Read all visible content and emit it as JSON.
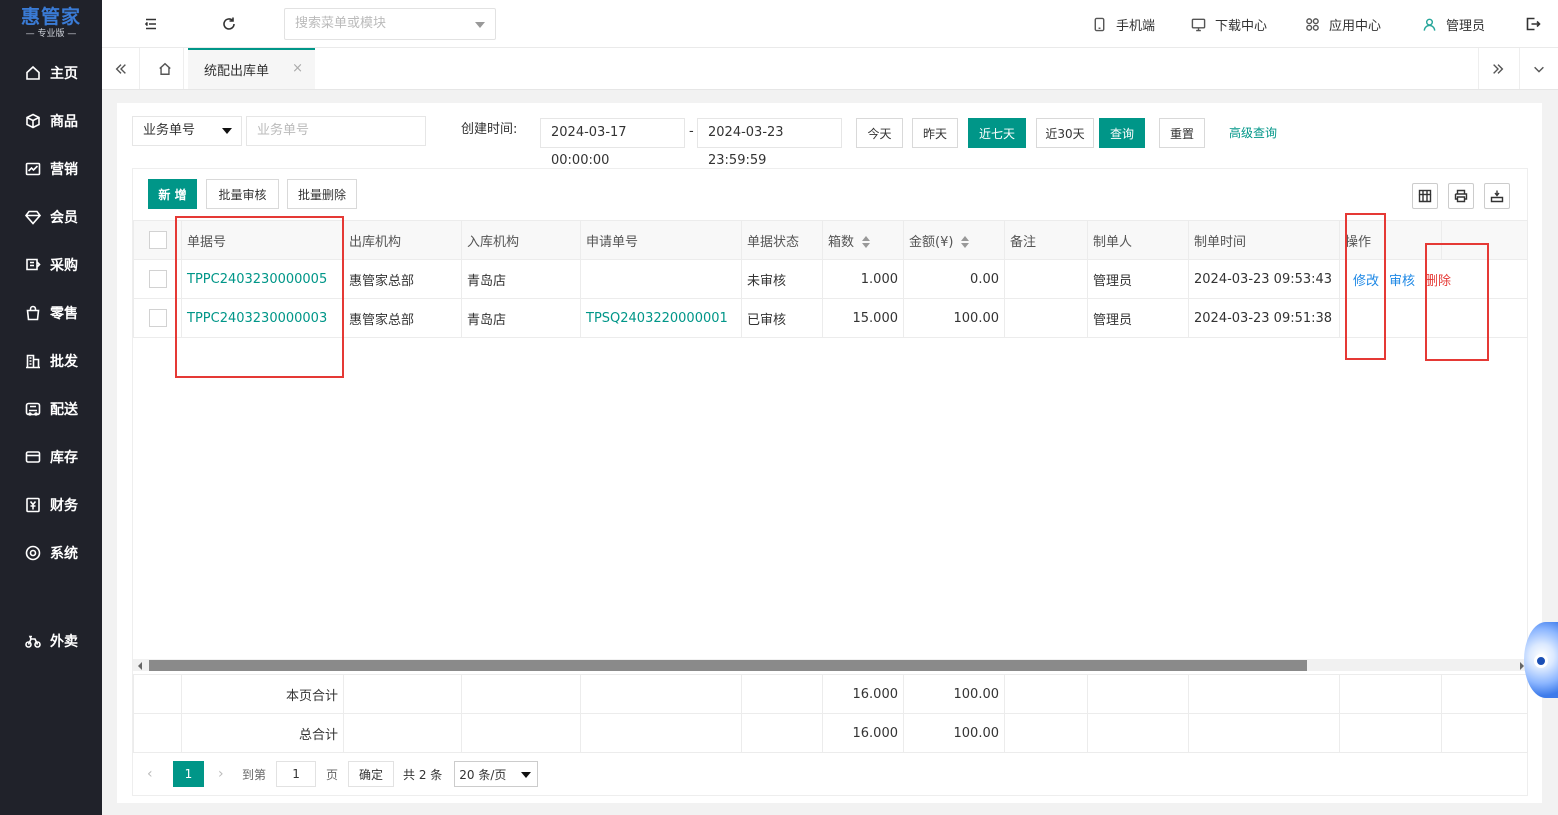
{
  "brand": {
    "name": "惠管家",
    "edition": "专业版",
    "accent": "#3a7bd5"
  },
  "colors": {
    "primary": "#009688",
    "sidebar_bg": "#20222a",
    "link_blue": "#1e88e5",
    "danger": "#e53935"
  },
  "sidebar": {
    "items": [
      {
        "label": "主页",
        "icon": "home-icon"
      },
      {
        "label": "商品",
        "icon": "box-icon"
      },
      {
        "label": "营销",
        "icon": "chart-icon"
      },
      {
        "label": "会员",
        "icon": "diamond-icon"
      },
      {
        "label": "采购",
        "icon": "purchase-icon"
      },
      {
        "label": "零售",
        "icon": "bag-icon"
      },
      {
        "label": "批发",
        "icon": "building-icon"
      },
      {
        "label": "配送",
        "icon": "truck-icon"
      },
      {
        "label": "库存",
        "icon": "stock-icon"
      },
      {
        "label": "财务",
        "icon": "money-icon"
      },
      {
        "label": "系统",
        "icon": "settings-icon"
      },
      {
        "label": "外卖",
        "icon": "bike-icon"
      }
    ]
  },
  "header": {
    "search_placeholder": "搜索菜单或模块",
    "links": {
      "mobile": "手机端",
      "download": "下载中心",
      "apps": "应用中心",
      "user": "管理员"
    }
  },
  "tabs": {
    "active": "统配出库单",
    "close": "×"
  },
  "filter": {
    "field_select": "业务单号",
    "field_placeholder": "业务单号",
    "created_label": "创建时间:",
    "date_from": "2024-03-17 00:00:00",
    "date_sep": "-",
    "date_to": "2024-03-23 23:59:59",
    "today": "今天",
    "yesterday": "昨天",
    "last7": "近七天",
    "last30": "近30天",
    "query": "查询",
    "reset": "重置",
    "advanced": "高级查询"
  },
  "toolbar": {
    "add": "新 增",
    "batch_audit": "批量审核",
    "batch_delete": "批量删除"
  },
  "table": {
    "columns": [
      "单据号",
      "出库机构",
      "入库机构",
      "申请单号",
      "单据状态",
      "箱数",
      "金额(¥)",
      "备注",
      "制单人",
      "制单时间",
      "操作"
    ],
    "rows": [
      {
        "doc_no": "TPPC2403230000005",
        "out_org": "惠管家总部",
        "in_org": "青岛店",
        "apply_no": "",
        "status": "未审核",
        "boxes": "1.000",
        "amount": "0.00",
        "remark": "",
        "maker": "管理员",
        "time": "2024-03-23 09:53:43",
        "op_edit": "修改",
        "op_audit": "审核",
        "op_delete": "删除"
      },
      {
        "doc_no": "TPPC2403230000003",
        "out_org": "惠管家总部",
        "in_org": "青岛店",
        "apply_no": "TPSQ2403220000001",
        "status": "已审核",
        "boxes": "15.000",
        "amount": "100.00",
        "remark": "",
        "maker": "管理员",
        "time": "2024-03-23 09:51:38",
        "op_edit": "",
        "op_audit": "",
        "op_delete": ""
      }
    ],
    "totals": [
      {
        "label": "本页合计",
        "boxes": "16.000",
        "amount": "100.00"
      },
      {
        "label": "总合计",
        "boxes": "16.000",
        "amount": "100.00"
      }
    ]
  },
  "pager": {
    "current": "1",
    "goto_label": "到第",
    "goto_value": "1",
    "page_unit": "页",
    "confirm": "确定",
    "total": "共 2 条",
    "page_size": "20 条/页"
  }
}
